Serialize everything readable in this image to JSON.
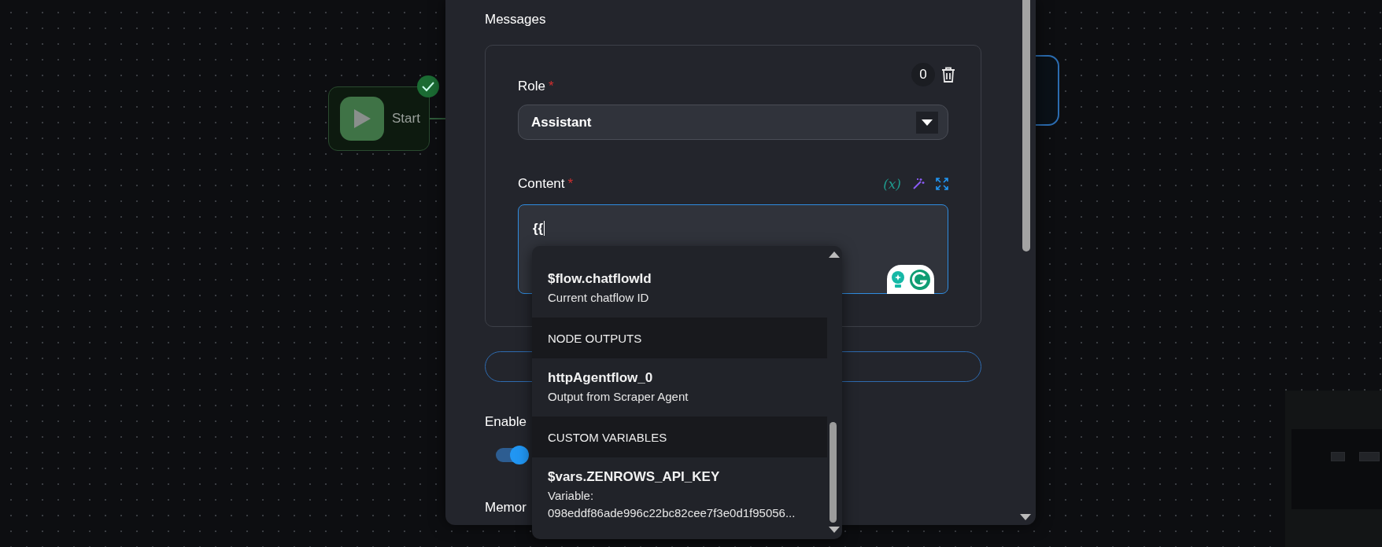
{
  "canvas": {
    "nodes": [
      {
        "kind": "start",
        "label": "Start",
        "completed": true
      },
      {
        "kind": "agent",
        "selected": true
      }
    ]
  },
  "dialog": {
    "section_title": "Messages",
    "messages": [
      {
        "count": "0",
        "role": {
          "label": "Role",
          "mark": "*",
          "value": "Assistant"
        },
        "content": {
          "label": "Content",
          "mark": "*",
          "variable_button": "(x)",
          "value": "{{"
        }
      }
    ],
    "toggle": {
      "label": "Enable",
      "on": true
    },
    "next_label": "Memor"
  },
  "suggestions": {
    "items": [
      {
        "kind": "option",
        "title": "$flow.chatflowId",
        "description": "Current chatflow ID"
      },
      {
        "kind": "header",
        "title": "NODE OUTPUTS"
      },
      {
        "kind": "option",
        "title": "httpAgentflow_0",
        "description": "Output from Scraper Agent"
      },
      {
        "kind": "header",
        "title": "CUSTOM VARIABLES"
      },
      {
        "kind": "option",
        "title": "$vars.ZENROWS_API_KEY",
        "description": "Variable: 098eddf86ade996c22bc82cee7f3e0d1f95056..."
      }
    ]
  }
}
